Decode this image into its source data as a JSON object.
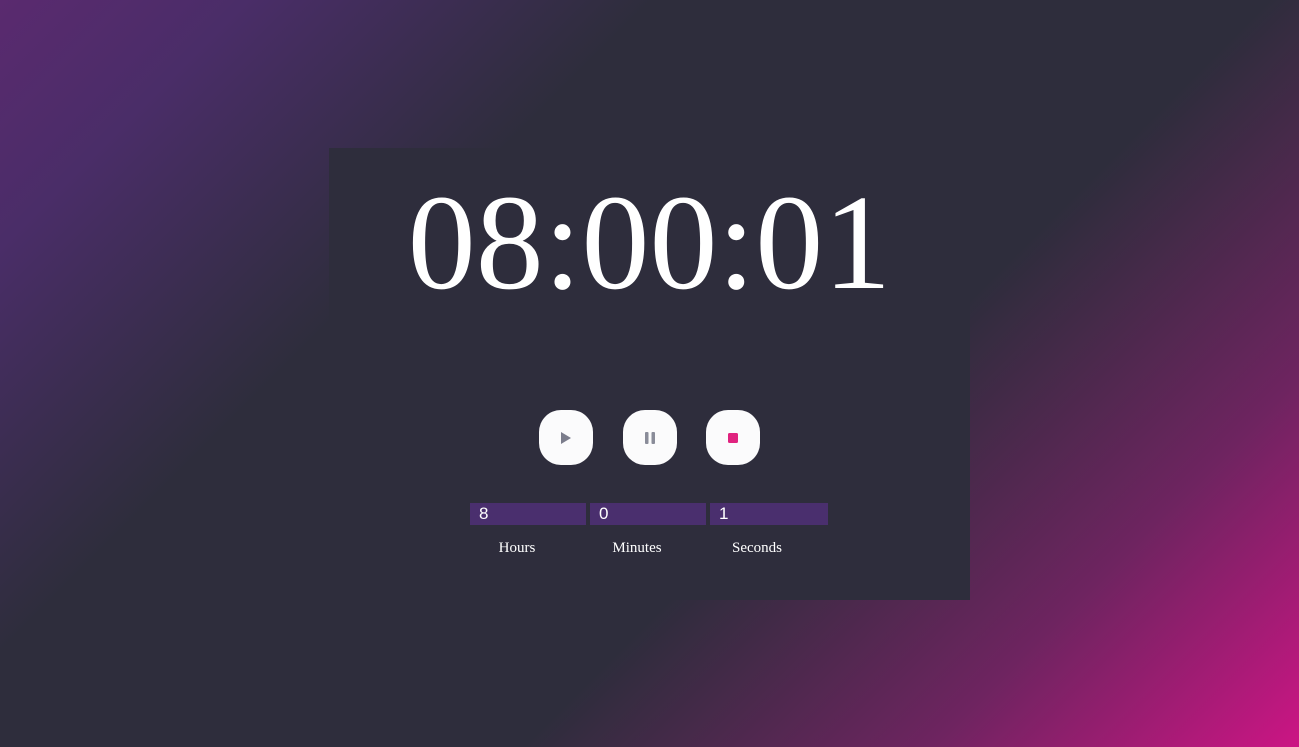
{
  "timer": {
    "display": "08:00:01"
  },
  "controls": {
    "play_icon": "play-icon",
    "pause_icon": "pause-icon",
    "stop_icon": "stop-icon",
    "stop_color": "#e0237f"
  },
  "inputs": {
    "hours": {
      "value": "8",
      "label": "Hours"
    },
    "minutes": {
      "value": "0",
      "label": "Minutes"
    },
    "seconds": {
      "value": "1",
      "label": "Seconds"
    }
  },
  "colors": {
    "background": "#2e2d3c",
    "accent_purple": "#4a2f6e",
    "accent_pink": "#cc1584"
  }
}
